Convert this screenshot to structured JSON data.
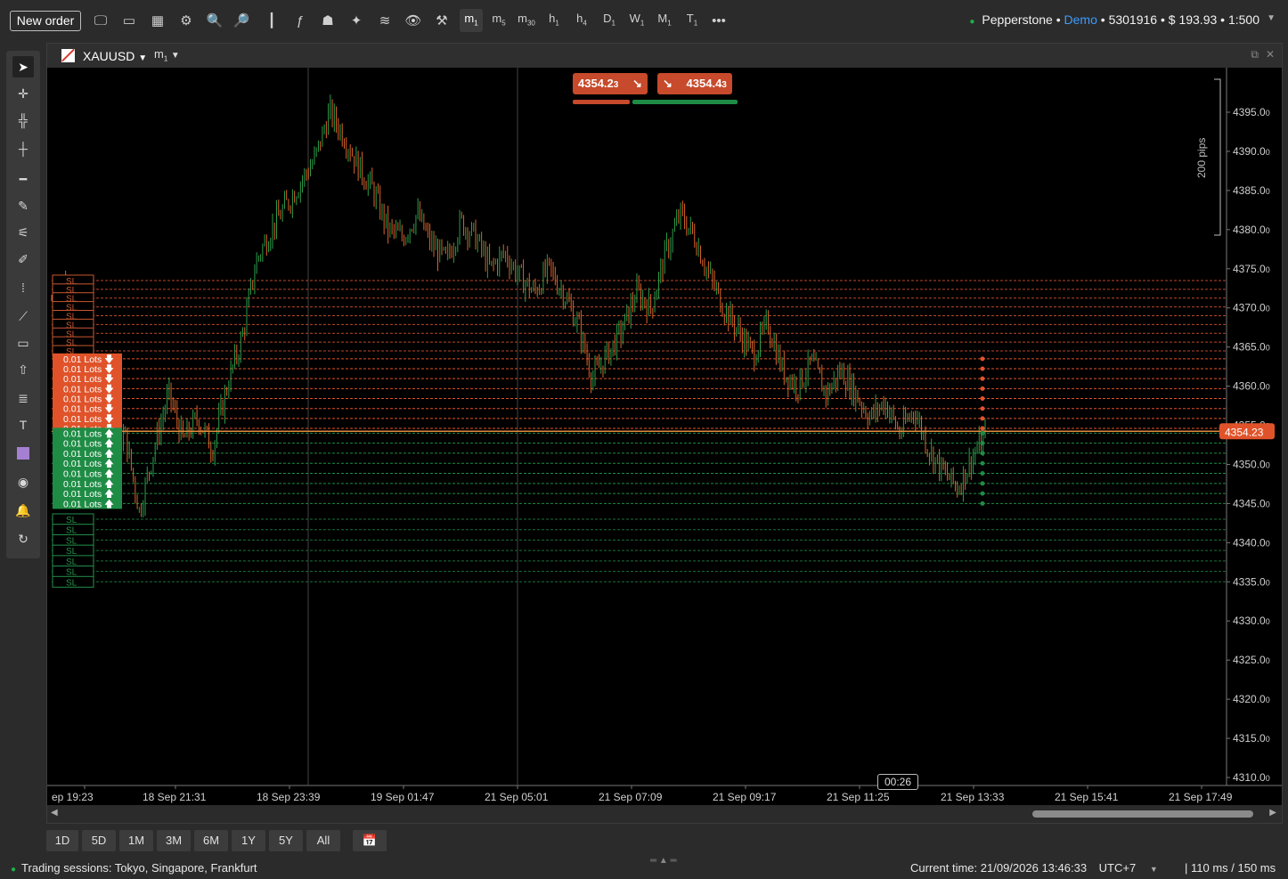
{
  "toolbar": {
    "new_order": "New order",
    "timeframes": [
      {
        "label": "m",
        "sub": "1",
        "active": true
      },
      {
        "label": "m",
        "sub": "5",
        "active": false
      },
      {
        "label": "m",
        "sub": "30",
        "active": false
      },
      {
        "label": "h",
        "sub": "1",
        "active": false
      },
      {
        "label": "h",
        "sub": "4",
        "active": false
      },
      {
        "label": "D",
        "sub": "1",
        "active": false
      },
      {
        "label": "W",
        "sub": "1",
        "active": false
      },
      {
        "label": "M",
        "sub": "1",
        "active": false
      },
      {
        "label": "T",
        "sub": "1",
        "active": false
      }
    ],
    "more": "•••",
    "account": {
      "broker": "Pepperstone",
      "mode": "Demo",
      "number": "5301916",
      "balance": "$ 193.93",
      "leverage": "1:500"
    }
  },
  "chart": {
    "symbol": "XAUUSD",
    "timeframe": "m",
    "timeframe_sub": "1",
    "bid": {
      "main": "4354.2",
      "small": "3"
    },
    "ask": {
      "main": "4354.4",
      "small": "3"
    },
    "current_price_label": "4354.23",
    "ruler_label": "200 pips",
    "bar_timer": "00:26",
    "y_ticks": [
      "4395.0",
      "4390.0",
      "4385.0",
      "4380.0",
      "4375.0",
      "4370.0",
      "4365.0",
      "4360.0",
      "4355.0",
      "4350.0",
      "4345.0",
      "4340.0",
      "4335.0",
      "4330.0",
      "4325.0",
      "4320.0",
      "4315.0",
      "4310.0"
    ],
    "y_ticks_small": "0",
    "x_ticks": [
      "ep 19:23",
      "18 Sep 21:31",
      "18 Sep 23:39",
      "19 Sep 01:47",
      "21 Sep 05:01",
      "21 Sep 07:09",
      "21 Sep 09:17",
      "21 Sep 11:25",
      "21 Sep 13:33",
      "21 Sep 15:41",
      "21 Sep 17:49"
    ],
    "sell_order_label": "0.01 Lots",
    "buy_order_label": "0.01 Lots",
    "sl_label": "SL",
    "colors": {
      "bull": "#2e9c4a",
      "bear": "#d9642b",
      "sell": "#e0532a",
      "buy": "#1f8c45"
    }
  },
  "chart_data": {
    "type": "candlestick",
    "symbol": "XAUUSD",
    "ylim": [
      4308,
      4398
    ],
    "close_path": [
      4371,
      4374,
      4368,
      4356,
      4350,
      4354,
      4344,
      4352,
      4359,
      4353,
      4356,
      4352,
      4360,
      4366,
      4376,
      4380,
      4383,
      4386,
      4389,
      4395,
      4392,
      4388,
      4385,
      4380,
      4379,
      4382,
      4378,
      4376,
      4381,
      4379,
      4375,
      4377,
      4374,
      4372,
      4375,
      4372,
      4368,
      4361,
      4364,
      4367,
      4372,
      4370,
      4377,
      4382,
      4379,
      4374,
      4370,
      4367,
      4364,
      4368,
      4362,
      4360,
      4363,
      4359,
      4362,
      4359,
      4356,
      4358,
      4354,
      4357,
      4352,
      4349,
      4347,
      4351,
      4354
    ],
    "sell_orders": {
      "count": 8,
      "from": 4363.5,
      "to": 4354.6
    },
    "buy_orders": {
      "count": 8,
      "from": 4354.0,
      "to": 4345.0
    },
    "sell_stop_losses": {
      "count": 9,
      "from": 4373.5,
      "to": 4364.5
    },
    "buy_stop_losses": {
      "count": 7,
      "from": 4343.0,
      "to": 4335.0
    }
  },
  "periods": [
    "1D",
    "5D",
    "1M",
    "3M",
    "6M",
    "1Y",
    "5Y",
    "All"
  ],
  "status": {
    "sessions": "Trading sessions: Tokyo, Singapore, Frankfurt",
    "current_time_label": "Current time:",
    "current_time": "21/09/2026 13:46:33",
    "timezone": "UTC+7",
    "latency": "| 110 ms / 150 ms"
  }
}
